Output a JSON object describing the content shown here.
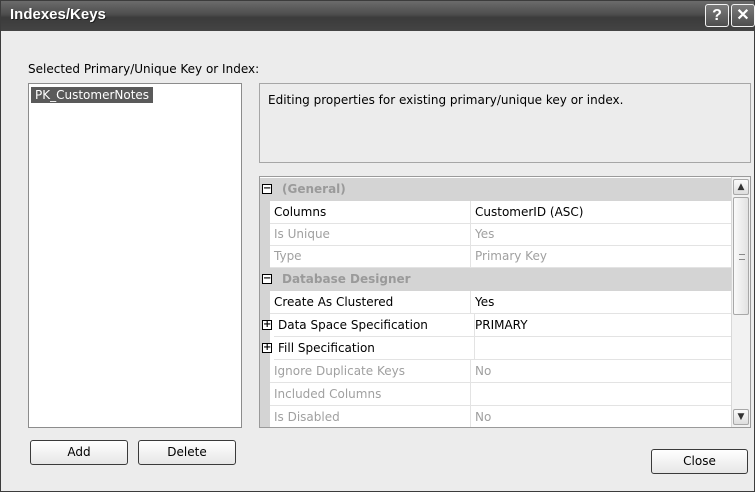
{
  "window": {
    "title": "Indexes/Keys",
    "help_glyph": "?",
    "close_glyph": "✕"
  },
  "selection": {
    "label": "Selected Primary/Unique Key or Index:",
    "items": [
      "PK_CustomerNotes"
    ]
  },
  "description": "Editing properties for existing primary/unique key or index.",
  "properties": {
    "categories": [
      {
        "label": "(General)",
        "rows": [
          {
            "name": "Columns",
            "value": "CustomerID (ASC)",
            "enabled": true
          },
          {
            "name": "Is Unique",
            "value": "Yes",
            "enabled": false
          },
          {
            "name": "Type",
            "value": "Primary Key",
            "enabled": false
          }
        ]
      },
      {
        "label": "Database Designer",
        "rows": [
          {
            "name": "Create As Clustered",
            "value": "Yes",
            "enabled": true
          },
          {
            "name": "Data Space Specification",
            "value": "PRIMARY",
            "enabled": true,
            "expandable": true
          },
          {
            "name": "Fill Specification",
            "value": "",
            "enabled": true,
            "expandable": true
          },
          {
            "name": "Ignore Duplicate Keys",
            "value": "No",
            "enabled": false
          },
          {
            "name": "Included Columns",
            "value": "",
            "enabled": false
          },
          {
            "name": "Is Disabled",
            "value": "No",
            "enabled": false
          }
        ]
      }
    ]
  },
  "buttons": {
    "add": "Add",
    "delete": "Delete",
    "close": "Close"
  },
  "icons": {
    "collapse": "minus-box-icon",
    "expand": "plus-box-icon"
  },
  "colors": {
    "title_bar": "#4d4d4d",
    "selection_bg": "#5a5a5a",
    "category_bg": "#d4d4d4",
    "disabled_text": "#a0a0a0"
  }
}
